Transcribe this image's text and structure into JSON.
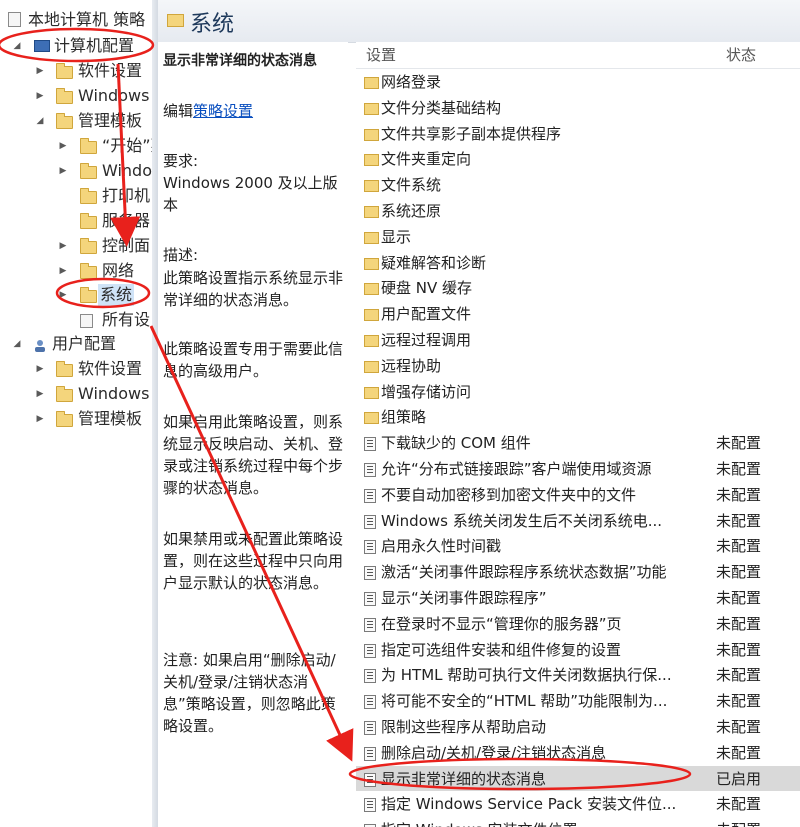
{
  "tree": {
    "root": "本地计算机 策略",
    "computer_config": "计算机配置",
    "software_settings": "软件设置",
    "windows_settings": "Windows",
    "admin_templates": "管理模板",
    "start_menu": "“开始”菜",
    "windows_components": "Windo",
    "printers": "打印机",
    "server": "服务器",
    "control_panel": "控制面",
    "network": "网络",
    "system": "系统",
    "all_settings": "所有设",
    "user_config": "用户配置",
    "user_software": "软件设置",
    "user_windows": "Windows",
    "user_admin": "管理模板"
  },
  "header": {
    "title": "系统"
  },
  "description": {
    "title": "显示非常详细的状态消息",
    "edit_prefix": "编辑",
    "edit_link": "策略设置",
    "req_label": "要求:",
    "req_text": "Windows 2000 及以上版本",
    "desc_label": "描述:",
    "desc_text": "此策略设置指示系统显示非常详细的状态消息。",
    "para2": "此策略设置专用于需要此信息的高级用户。",
    "para3": "如果启用此策略设置，则系统显示反映启动、关机、登录或注销系统过程中每个步骤的状态消息。",
    "para4": "如果禁用或未配置此策略设置，则在这些过程中只向用户显示默认的状态消息。",
    "para5": "注意: 如果启用“删除启动/关机/登录/注销状态消息”策略设置，则忽略此策略设置。"
  },
  "list": {
    "col_setting": "设置",
    "col_state": "状态",
    "rows": [
      {
        "name": "网络登录",
        "state": "",
        "kind": "folder"
      },
      {
        "name": "文件分类基础结构",
        "state": "",
        "kind": "folder"
      },
      {
        "name": "文件共享影子副本提供程序",
        "state": "",
        "kind": "folder"
      },
      {
        "name": "文件夹重定向",
        "state": "",
        "kind": "folder"
      },
      {
        "name": "文件系统",
        "state": "",
        "kind": "folder"
      },
      {
        "name": "系统还原",
        "state": "",
        "kind": "folder"
      },
      {
        "name": "显示",
        "state": "",
        "kind": "folder"
      },
      {
        "name": "疑难解答和诊断",
        "state": "",
        "kind": "folder"
      },
      {
        "name": "硬盘 NV 缓存",
        "state": "",
        "kind": "folder"
      },
      {
        "name": "用户配置文件",
        "state": "",
        "kind": "folder"
      },
      {
        "name": "远程过程调用",
        "state": "",
        "kind": "folder"
      },
      {
        "name": "远程协助",
        "state": "",
        "kind": "folder"
      },
      {
        "name": "增强存储访问",
        "state": "",
        "kind": "folder"
      },
      {
        "name": "组策略",
        "state": "",
        "kind": "folder"
      },
      {
        "name": "下载缺少的 COM 组件",
        "state": "未配置",
        "kind": "policy"
      },
      {
        "name": "允许“分布式链接跟踪”客户端使用域资源",
        "state": "未配置",
        "kind": "policy"
      },
      {
        "name": "不要自动加密移到加密文件夹中的文件",
        "state": "未配置",
        "kind": "policy"
      },
      {
        "name": "Windows 系统关闭发生后不关闭系统电...",
        "state": "未配置",
        "kind": "policy"
      },
      {
        "name": "启用永久性时间戳",
        "state": "未配置",
        "kind": "policy"
      },
      {
        "name": "激活“关闭事件跟踪程序系统状态数据”功能",
        "state": "未配置",
        "kind": "policy"
      },
      {
        "name": "显示“关闭事件跟踪程序”",
        "state": "未配置",
        "kind": "policy"
      },
      {
        "name": "在登录时不显示“管理你的服务器”页",
        "state": "未配置",
        "kind": "policy"
      },
      {
        "name": "指定可选组件安装和组件修复的设置",
        "state": "未配置",
        "kind": "policy"
      },
      {
        "name": "为 HTML 帮助可执行文件关闭数据执行保...",
        "state": "未配置",
        "kind": "policy"
      },
      {
        "name": "将可能不安全的“HTML 帮助”功能限制为...",
        "state": "未配置",
        "kind": "policy"
      },
      {
        "name": "限制这些程序从帮助启动",
        "state": "未配置",
        "kind": "policy"
      },
      {
        "name": "删除启动/关机/登录/注销状态消息",
        "state": "未配置",
        "kind": "policy"
      },
      {
        "name": "显示非常详细的状态消息",
        "state": "已启用",
        "kind": "policy",
        "selected": true
      },
      {
        "name": "指定 Windows Service Pack 安装文件位...",
        "state": "未配置",
        "kind": "policy"
      },
      {
        "name": "指定 Windows 安装文件位置",
        "state": "未配置",
        "kind": "policy"
      }
    ]
  },
  "colors": {
    "annotation": "#e8211c",
    "selected_row": "#d9d9d9",
    "folder": "#f4d57c",
    "link": "#0a4fbf"
  }
}
